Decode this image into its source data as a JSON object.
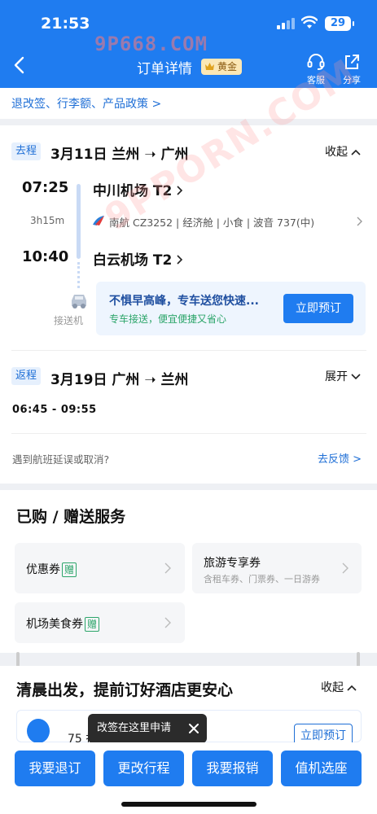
{
  "status_bar": {
    "time": "21:53",
    "battery": "29"
  },
  "nav": {
    "title": "订单详情",
    "badge": "黄金",
    "service_label": "客服",
    "share_label": "分享"
  },
  "watermark": {
    "top": "9P668.COM",
    "diagonal": "9PPORN.COM"
  },
  "policy_link": "退改签、行李额、产品政策 >",
  "outbound": {
    "tag": "去程",
    "title": "3月11日 兰州 ➝ 广州",
    "collapse": "收起",
    "depart_time": "07:25",
    "depart_airport": "中川机场 T2",
    "duration": "3h15m",
    "flight_info": "南航 CZ3252 | 经济舱 | 小食 | 波音 737(中)",
    "arrive_time": "10:40",
    "arrive_airport": "白云机场 T2",
    "transfer": {
      "title": "不惧早高峰，专车送您快速...",
      "subtitle": "专车接送，便宜便捷又省心",
      "button": "立即预订",
      "label": "接送机"
    }
  },
  "return": {
    "tag": "返程",
    "title": "3月19日 广州 ➝ 兰州",
    "expand": "展开",
    "times": "06:45 - 09:55"
  },
  "delay": {
    "question": "遇到航班延误或取消?",
    "feedback": "去反馈 >"
  },
  "services": {
    "title": "已购 / 赠送服务",
    "gift_tag": "赠",
    "items": [
      {
        "name": "优惠券",
        "gift": true,
        "sub": ""
      },
      {
        "name": "旅游专享券",
        "gift": false,
        "sub": "含租车券、门票券、一日游券"
      },
      {
        "name": "机场美食券",
        "gift": true,
        "sub": ""
      }
    ]
  },
  "hotel": {
    "title": "清晨出发，提前订好酒店更安心",
    "collapse": "收起",
    "text": "75 折起",
    "button": "立即预订"
  },
  "tooltip": {
    "text": "改签在这里申请"
  },
  "bottom_buttons": [
    "我要退订",
    "更改行程",
    "我要报销",
    "值机选座"
  ],
  "colors": {
    "brand": "#1f7cf0",
    "link": "#1f6fd6",
    "gift_green": "#2ca56a"
  }
}
